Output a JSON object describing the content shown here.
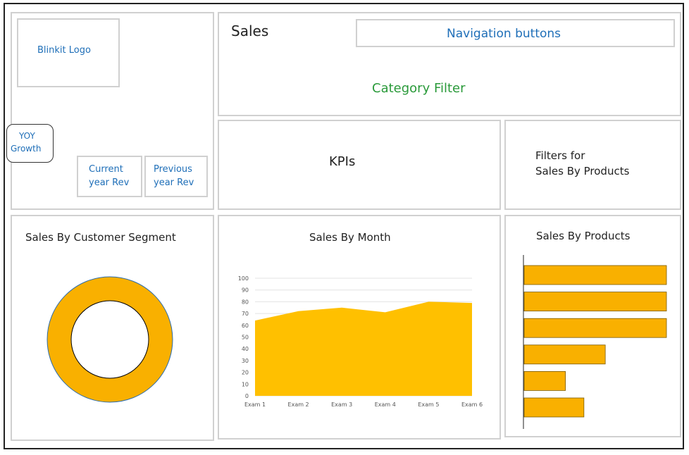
{
  "logo": {
    "label": "Blinkit Logo"
  },
  "yoy": {
    "label_line1": "YOY",
    "label_line2": "Growth"
  },
  "current_rev": {
    "line1": "Current",
    "line2": "year Rev"
  },
  "previous_rev": {
    "line1": "Previous",
    "line2": "year Rev"
  },
  "header": {
    "title": "Sales",
    "navigation": "Navigation buttons",
    "category_filter": "Category Filter"
  },
  "kpis": {
    "label": "KPIs"
  },
  "filters": {
    "line1": "Filters for",
    "line2": "Sales By Products"
  },
  "segment": {
    "title": "Sales By Customer Segment"
  },
  "month": {
    "title": "Sales By Month"
  },
  "products": {
    "title": "Sales By Products"
  },
  "colors": {
    "accent": "#f9b000",
    "area": "#ffc000",
    "blue_text": "#1f6fb8",
    "green_text": "#2a9a3a"
  },
  "chart_data": [
    {
      "type": "pie",
      "title": "Sales By Customer Segment",
      "values": [
        100
      ],
      "style": "donut"
    },
    {
      "type": "area",
      "title": "Sales By Month",
      "categories": [
        "Exam 1",
        "Exam 2",
        "Exam 3",
        "Exam 4",
        "Exam 5",
        "Exam 6"
      ],
      "values": [
        64,
        72,
        75,
        71,
        80,
        79
      ],
      "ylim": [
        0,
        100
      ],
      "yticks": [
        0,
        10,
        20,
        30,
        40,
        50,
        60,
        70,
        80,
        90,
        100
      ],
      "grid": true
    },
    {
      "type": "bar",
      "orientation": "horizontal",
      "title": "Sales By Products",
      "values": [
        100,
        100,
        100,
        57,
        29,
        42
      ]
    }
  ]
}
